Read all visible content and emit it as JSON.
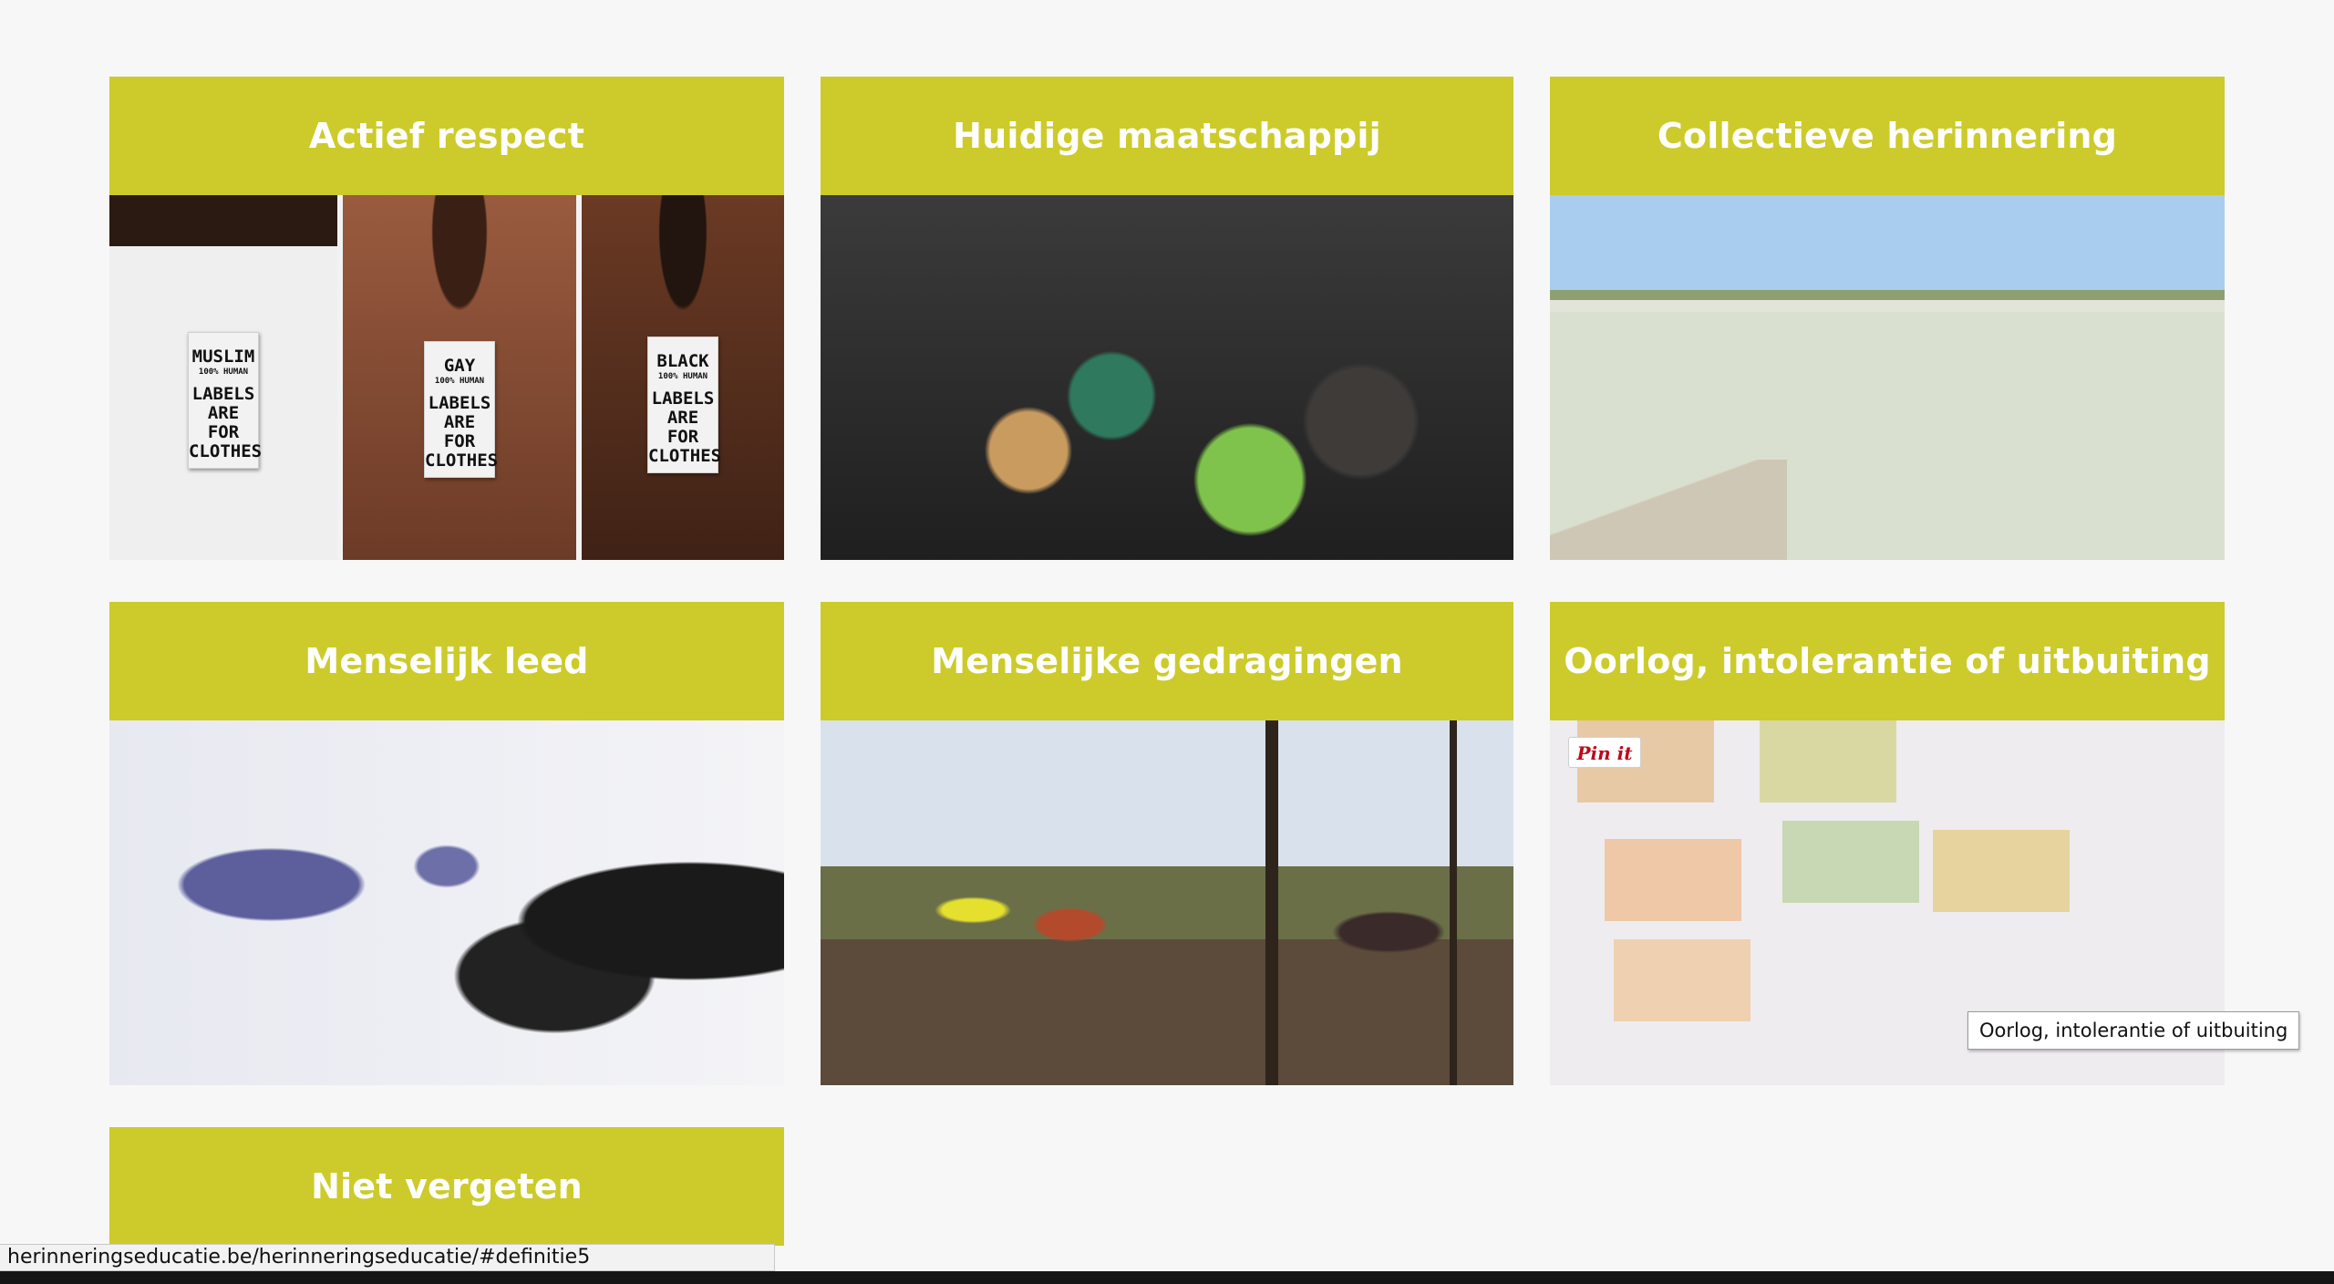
{
  "cards": [
    {
      "title": "Actief respect",
      "image_alt": "Actief respect"
    },
    {
      "title": "Huidige maatschappij",
      "image_alt": "Huidige maatschappij"
    },
    {
      "title": "Collectieve herinnering",
      "image_alt": "Collectieve herinnering"
    },
    {
      "title": "Menselijk leed",
      "image_alt": "Menselijk leed"
    },
    {
      "title": "Menselijke gedragingen",
      "image_alt": "Menselijke gedragingen"
    },
    {
      "title": "Oorlog, intolerantie of uitbuiting",
      "image_alt": "Oorlog, intolerantie of uitbuiting"
    },
    {
      "title": "Niet vergeten"
    }
  ],
  "respect_tags": [
    {
      "word": "MUSLIM",
      "sub": "100% HUMAN",
      "line1": "LABELS",
      "line2": "ARE FOR",
      "line3": "CLOTHES"
    },
    {
      "word": "GAY",
      "sub": "100% HUMAN",
      "line1": "LABELS",
      "line2": "ARE FOR",
      "line3": "CLOTHES"
    },
    {
      "word": "BLACK",
      "sub": "100% HUMAN",
      "line1": "LABELS",
      "line2": "ARE FOR",
      "line3": "CLOTHES"
    }
  ],
  "pin_button": {
    "label": "Pin it"
  },
  "tooltip": {
    "text": "Oorlog, intolerantie of uitbuiting"
  },
  "status_bar": {
    "url": "herinneringseducatie.be/herinneringseducatie/#definitie5"
  },
  "colors": {
    "card_header": "#cccb2b",
    "header_text": "#ffffff",
    "page_bg": "#f7f7f7",
    "pin_red": "#bd081c"
  }
}
